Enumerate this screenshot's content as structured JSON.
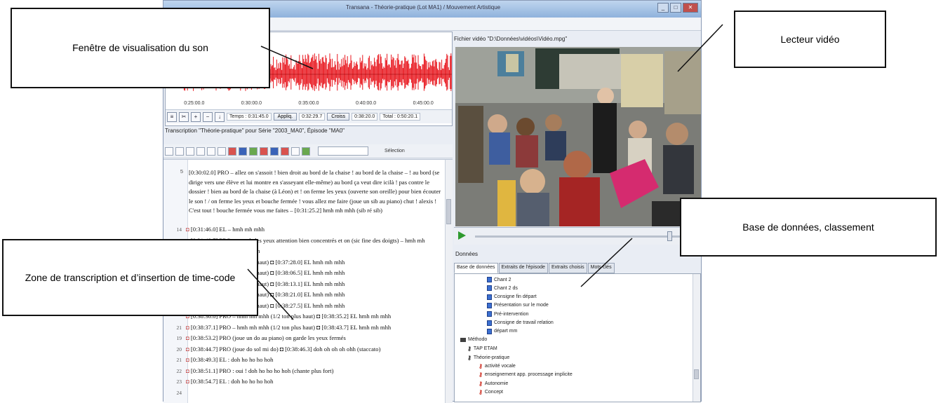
{
  "window": {
    "title": "Transana - Théorie-pratique (Lot MA1) / Mouvement Artistique",
    "buttons": [
      "_",
      "□",
      "✕"
    ]
  },
  "waveform": {
    "timestamps": [
      "0:25:00.0",
      "0:30:00.0",
      "0:35:00.0",
      "0:40:00.0",
      "0:45:00.0"
    ],
    "time_label": "Temps : 0:31:45.0",
    "apply_button": "Appliq.",
    "start_value": "0:32:29.7",
    "cross_button": "Croiss",
    "end_value": "0:38:20.0",
    "total_label": "Total : 0:50:20.1"
  },
  "transcription": {
    "header": "Transcription \"Théorie-pratique\" pour Série \"2003_MA0\", Épisode \"MA0\"",
    "select_label": "Sélection",
    "paragraph_line": "5",
    "paragraph": "[0:30:02.0] PRO – allez on s'assoit ! bien droit au bord de la chaise ! au bord de la chaise – ! au bord (se dirige vers une élève et lui montre en s'asseyant elle-même) au bord ça veut dire icilà ! pas contre le dossier ! bien au bord de la chaise (à Léon) et ! on ferme les yeux (ouverte son oreille) pour bien écouter le son ! / on ferme les yeux et bouche fermée ! vous allez me faire (joue un sib au piano) chut ! alexis ! C'est tout ! bouche fermée vous me faites – [0:31:25.2] hmh mh mhh (sib ré sib)",
    "rows": [
      {
        "ln": "14",
        "text": "[0:31:46.0] EL – hmh mh mhh"
      },
      {
        "ln": "17",
        "text": "[0:31:48.7] PRO on garde les yeux attention bien concentrés et on (sic fine des doigts) – hmh mh"
      },
      {
        "ln": "",
        "text": "[0:31:58.2] EL hmh mh mhh"
      },
      {
        "ln": "",
        "text": "hmh mh mhh (1/2 ton plus haut) ◘ [0:37:28.0] EL hmh mh mhh"
      },
      {
        "ln": "",
        "text": "hmh mh mhh (1/2 ton plus haut) ◘ [0:38:06.5] EL hmh mh mhh"
      },
      {
        "ln": "",
        "text": "hmh mh mhh (1/2 ton plus haut) ◘ [0:38:13.1] EL hmh mh mhh"
      },
      {
        "ln": "",
        "text": "hmh mh mhh (1/2 ton plus haut) ◘ [0:38:21.0] EL hmh mh mhh"
      },
      {
        "ln": "",
        "text": "hmh mh mhh (1/2 ton plus haut) ◘ [0:38:27.5] EL hmh mh mhh"
      },
      {
        "ln": "",
        "text": "[0:38:30.0] PRO – hmh mh mhh (1/2 ton plus haut) ◘ [0:38:35.2] EL hmh mh mhh"
      },
      {
        "ln": "21",
        "text": "[0:38:37.1] PRO – hmh mh mhh (1/2 ton plus haut) ◘ [0:38:43.7] EL hmh mh mhh"
      },
      {
        "ln": "19",
        "text": "[0:38:53.2] PRO (joue un do au piano) on garde les yeux fermés"
      },
      {
        "ln": "20",
        "text": "[0:38:44.7] PRO (joue do sol mi do) ◘ [0:38:46.3] doh oh oh oh ohh (staccato)"
      },
      {
        "ln": "21",
        "text": "[0:38:49.3] EL : doh ho ho ho hoh"
      },
      {
        "ln": "22",
        "text": "[0:38:51.1] PRO : oui ! doh ho ho ho hoh (chante plus fort)"
      },
      {
        "ln": "23",
        "text": "[0:38:54.7] EL : doh ho ho ho hoh"
      },
      {
        "ln": "24",
        "text": ""
      }
    ]
  },
  "video": {
    "header": "Fichier vidéo \"D:\\Données\\vidéos\\Vidéo.mpg\""
  },
  "database": {
    "header": "Données",
    "tabs": [
      "Base de données",
      "Extraits de l'épisode",
      "Extraits choisis",
      "Mots-clés"
    ],
    "items": [
      {
        "type": "doc",
        "label": "Chant 2"
      },
      {
        "type": "doc",
        "label": "Chant 2 ds"
      },
      {
        "type": "doc",
        "label": "Consigne fin départ"
      },
      {
        "type": "doc",
        "label": "Présentation sur le mode"
      },
      {
        "type": "doc",
        "label": "Pré-intervention"
      },
      {
        "type": "doc",
        "label": "Consigne de travail relation"
      },
      {
        "type": "doc",
        "label": "départ mm"
      },
      {
        "type": "folder",
        "label": "Méthodo"
      },
      {
        "type": "key",
        "label": "TAP ETAM"
      },
      {
        "type": "key",
        "label": "Théorie-pratique"
      },
      {
        "type": "key-red",
        "label": "activité vocale"
      },
      {
        "type": "key-red",
        "label": "enseignement app. processage implicite"
      },
      {
        "type": "key-red",
        "label": "Autonomie"
      },
      {
        "type": "key-red",
        "label": "Concept"
      }
    ]
  },
  "callouts": {
    "sound": "Fenêtre de visualisation du son",
    "video": "Lecteur vidéo",
    "database": "Base de données, classement",
    "transcription": "Zone de transcription et d’insertion de time-code"
  },
  "colors": {
    "waveform": "#e8141c",
    "timecode": "#3355bb",
    "marker": "#c23b3b"
  }
}
